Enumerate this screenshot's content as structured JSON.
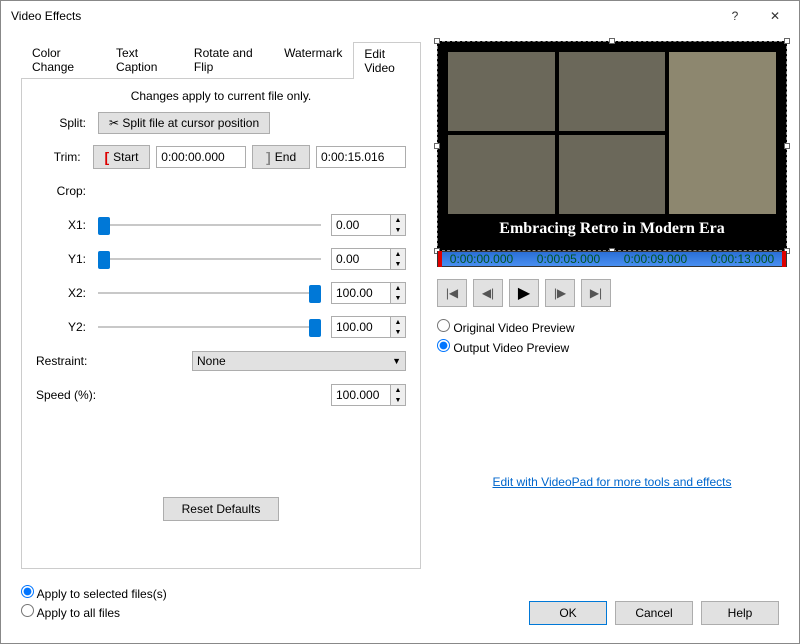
{
  "window": {
    "title": "Video Effects"
  },
  "tabs": [
    "Color Change",
    "Text Caption",
    "Rotate and Flip",
    "Watermark",
    "Edit Video"
  ],
  "active_tab": 4,
  "panel": {
    "hint": "Changes apply to current file only.",
    "split": {
      "label": "Split:",
      "button": "Split file at cursor position"
    },
    "trim": {
      "label": "Trim:",
      "start_btn": "Start",
      "start_time": "0:00:00.000",
      "end_btn": "End",
      "end_time": "0:00:15.016"
    },
    "crop": {
      "label": "Crop:",
      "x1": {
        "label": "X1:",
        "value": "0.00",
        "pos": 0
      },
      "y1": {
        "label": "Y1:",
        "value": "0.00",
        "pos": 0
      },
      "x2": {
        "label": "X2:",
        "value": "100.00",
        "pos": 100
      },
      "y2": {
        "label": "Y2:",
        "value": "100.00",
        "pos": 100
      }
    },
    "restraint": {
      "label": "Restraint:",
      "value": "None"
    },
    "speed": {
      "label": "Speed (%):",
      "value": "100.000"
    },
    "reset": "Reset Defaults"
  },
  "preview": {
    "caption": "Embracing Retro in Modern Era",
    "timeline_ticks": [
      "0:00:00.000",
      "0:00:05.000",
      "0:00:09.000",
      "0:00:13.000"
    ],
    "radios": {
      "original": "Original Video Preview",
      "output": "Output Video Preview",
      "selected": "output"
    },
    "link": "Edit with VideoPad for more tools and effects"
  },
  "apply": {
    "selected": "Apply to selected files(s)",
    "all": "Apply to all files",
    "choice": "selected"
  },
  "buttons": {
    "ok": "OK",
    "cancel": "Cancel",
    "help": "Help"
  }
}
